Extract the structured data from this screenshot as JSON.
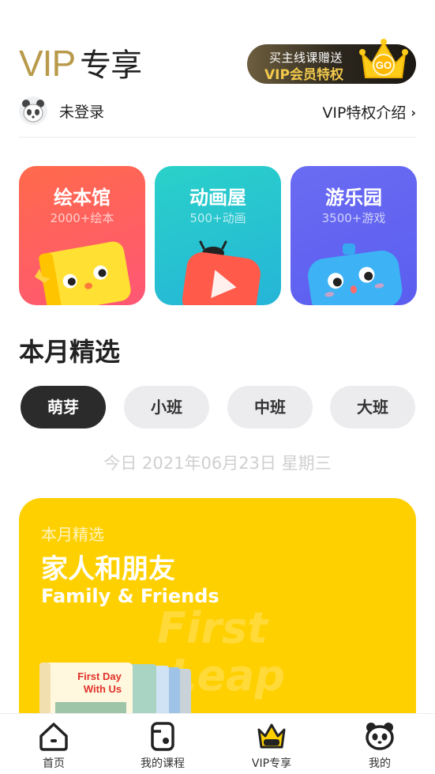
{
  "header": {
    "title_vip": "VIP",
    "title_zx": "专享",
    "promo_line1": "买主线课赠送",
    "promo_line2": "VIP会员特权",
    "promo_badge": "GO"
  },
  "user": {
    "login_status": "未登录",
    "vip_intro": "VIP特权介绍",
    "vip_intro_chevron": "›"
  },
  "categories": [
    {
      "title": "绘本馆",
      "subtitle": "2000+绘本",
      "icon": "book-mascot-icon",
      "color": "#ff6154"
    },
    {
      "title": "动画屋",
      "subtitle": "500+动画",
      "icon": "video-play-mascot-icon",
      "color": "#27c4d0"
    },
    {
      "title": "游乐园",
      "subtitle": "3500+游戏",
      "icon": "game-mascot-icon",
      "color": "#6365f1"
    }
  ],
  "section": {
    "title": "本月精选"
  },
  "level_tabs": [
    {
      "label": "萌芽",
      "active": true
    },
    {
      "label": "小班",
      "active": false
    },
    {
      "label": "中班",
      "active": false
    },
    {
      "label": "大班",
      "active": false
    }
  ],
  "date_text": "今日 2021年06月23日 星期三",
  "feature": {
    "kicker": "本月精选",
    "title": "家人和朋友",
    "title_en": "Family & Friends",
    "watermark_line1": "First",
    "watermark_line2": "Leap",
    "book_title_line1": "First Day",
    "book_title_line2": "With Us",
    "color": "#ffd000"
  },
  "tabbar": [
    {
      "label": "首页",
      "icon": "home-icon",
      "active": false
    },
    {
      "label": "我的课程",
      "icon": "course-icon",
      "active": false
    },
    {
      "label": "VIP专享",
      "icon": "vip-crown-icon",
      "active": true
    },
    {
      "label": "我的",
      "icon": "panda-profile-icon",
      "active": false
    }
  ]
}
